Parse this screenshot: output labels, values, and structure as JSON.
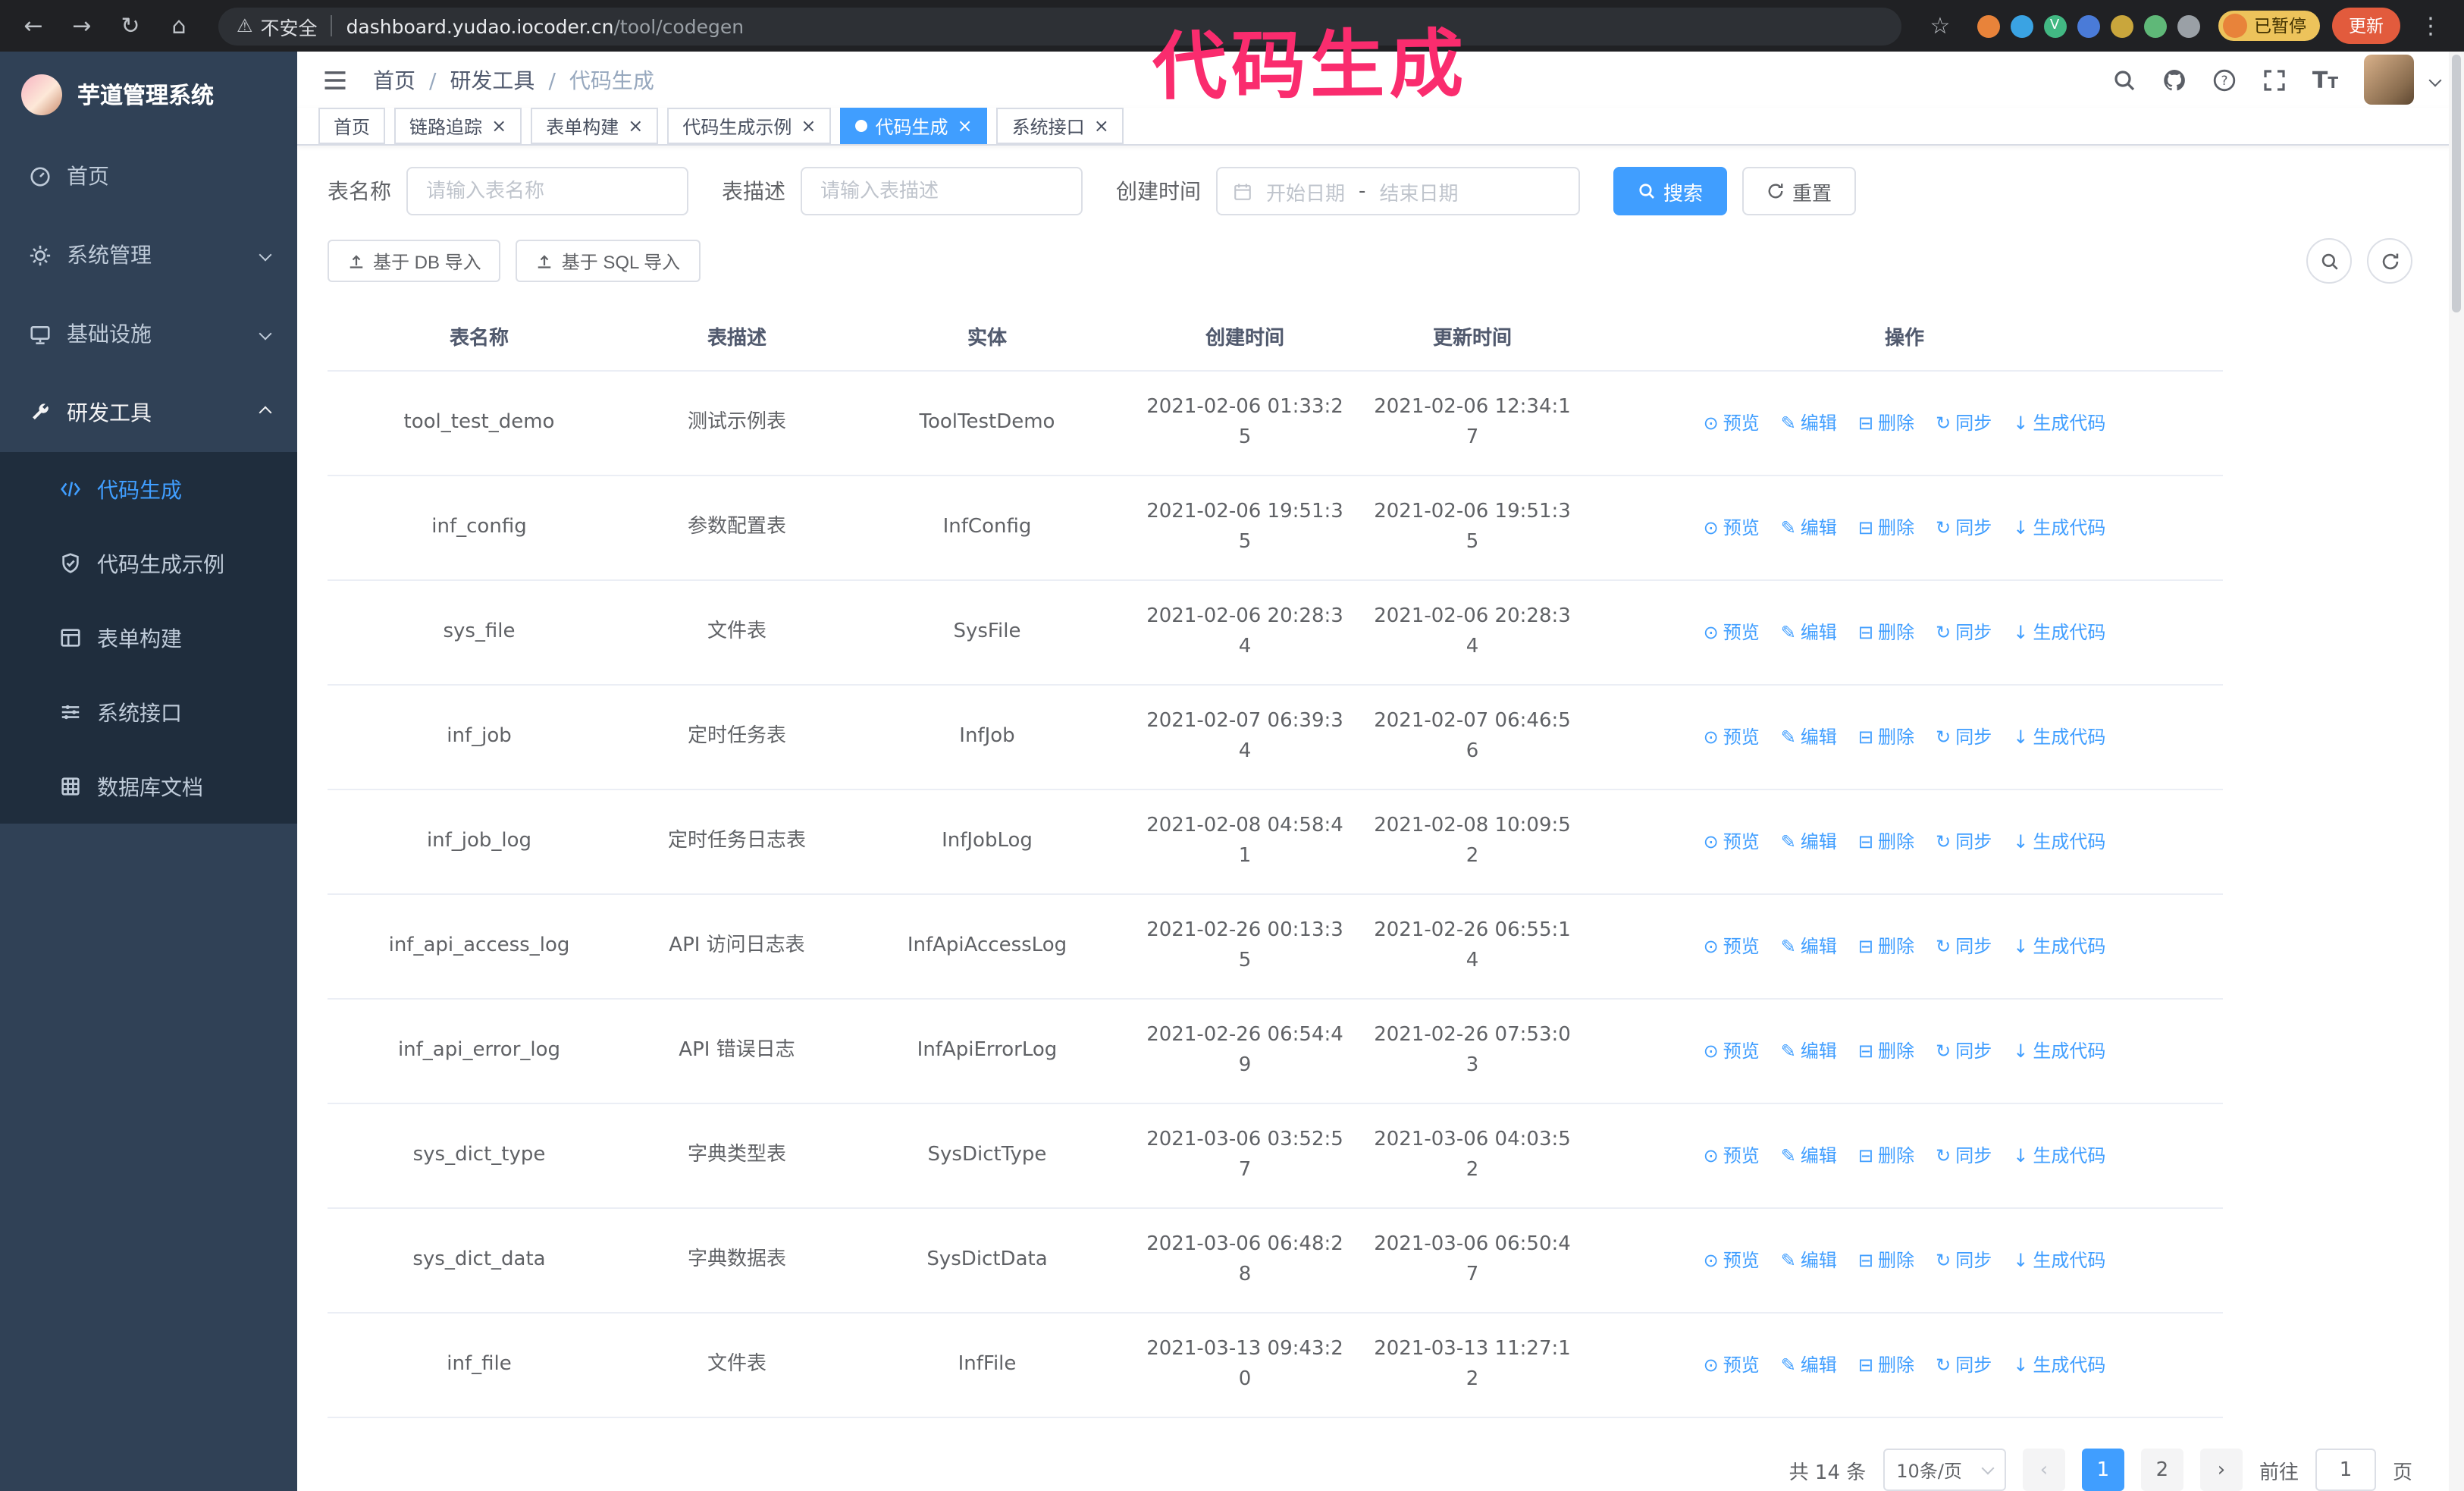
{
  "colors": {
    "accent": "#409eff",
    "annotation": "#fa2c6e",
    "sidebar_bg": "#304156",
    "submenu_bg": "#1f2d3d",
    "tab_active_bg": "#409eff"
  },
  "annotation": {
    "text": "代码生成"
  },
  "browser": {
    "security_label": "不安全",
    "domain": "dashboard.yudao.iocoder.cn",
    "path": "/tool/codegen",
    "profile_badge": "已暂停",
    "update_button": "更新",
    "extensions": [
      {
        "name": "extension-icon",
        "color": "#e8833a"
      },
      {
        "name": "extension-icon",
        "color": "#3aa3e3"
      },
      {
        "name": "vue-devtools-extension-icon",
        "color": "#42b883",
        "label": "V"
      },
      {
        "name": "extension-icon",
        "color": "#4a7bd8"
      },
      {
        "name": "extension-icon",
        "color": "#c9a63c"
      },
      {
        "name": "extension-icon",
        "color": "#5fb878"
      },
      {
        "name": "extensions-puzzle-icon",
        "color": "#9aa0a6"
      }
    ]
  },
  "sidebar": {
    "logo_title": "芋道管理系统",
    "items": [
      {
        "label": "首页",
        "icon": "dashboard-icon"
      },
      {
        "label": "系统管理",
        "icon": "gear-icon"
      },
      {
        "label": "基础设施",
        "icon": "infrastructure-icon"
      },
      {
        "label": "研发工具",
        "icon": "tools-icon"
      }
    ],
    "submenu": [
      {
        "label": "代码生成",
        "icon": "code-icon",
        "active": true
      },
      {
        "label": "代码生成示例",
        "icon": "example-icon"
      },
      {
        "label": "表单构建",
        "icon": "form-icon"
      },
      {
        "label": "系统接口",
        "icon": "api-icon"
      },
      {
        "label": "数据库文档",
        "icon": "database-icon"
      }
    ]
  },
  "header": {
    "breadcrumb": [
      "首页",
      "研发工具",
      "代码生成"
    ]
  },
  "tabs": [
    {
      "label": "首页",
      "closable": false,
      "active": false
    },
    {
      "label": "链路追踪",
      "closable": true,
      "active": false
    },
    {
      "label": "表单构建",
      "closable": true,
      "active": false
    },
    {
      "label": "代码生成示例",
      "closable": true,
      "active": false
    },
    {
      "label": "代码生成",
      "closable": true,
      "active": true
    },
    {
      "label": "系统接口",
      "closable": true,
      "active": false
    }
  ],
  "filters": {
    "table_name_label": "表名称",
    "table_name_placeholder": "请输入表名称",
    "table_desc_label": "表描述",
    "table_desc_placeholder": "请输入表描述",
    "create_time_label": "创建时间",
    "date_start_placeholder": "开始日期",
    "date_separator": "-",
    "date_end_placeholder": "结束日期",
    "search_button": "搜索",
    "reset_button": "重置"
  },
  "toolbar": {
    "import_db_label": "基于 DB 导入",
    "import_sql_label": "基于 SQL 导入"
  },
  "table": {
    "columns": [
      "表名称",
      "表描述",
      "实体",
      "创建时间",
      "更新时间",
      "操作"
    ],
    "actions": [
      {
        "label": "预览",
        "icon": "eye-icon",
        "name": "preview"
      },
      {
        "label": "编辑",
        "icon": "edit-icon",
        "name": "edit"
      },
      {
        "label": "删除",
        "icon": "trash-icon",
        "name": "delete"
      },
      {
        "label": "同步",
        "icon": "sync-icon",
        "name": "sync"
      },
      {
        "label": "生成代码",
        "icon": "generate-icon",
        "name": "generate-code"
      }
    ],
    "rows": [
      {
        "name": "tool_test_demo",
        "desc": "测试示例表",
        "entity": "ToolTestDemo",
        "created": "2021-02-06 01:33:25",
        "updated": "2021-02-06 12:34:17"
      },
      {
        "name": "inf_config",
        "desc": "参数配置表",
        "entity": "InfConfig",
        "created": "2021-02-06 19:51:35",
        "updated": "2021-02-06 19:51:35"
      },
      {
        "name": "sys_file",
        "desc": "文件表",
        "entity": "SysFile",
        "created": "2021-02-06 20:28:34",
        "updated": "2021-02-06 20:28:34"
      },
      {
        "name": "inf_job",
        "desc": "定时任务表",
        "entity": "InfJob",
        "created": "2021-02-07 06:39:34",
        "updated": "2021-02-07 06:46:56"
      },
      {
        "name": "inf_job_log",
        "desc": "定时任务日志表",
        "entity": "InfJobLog",
        "created": "2021-02-08 04:58:41",
        "updated": "2021-02-08 10:09:52"
      },
      {
        "name": "inf_api_access_log",
        "desc": "API 访问日志表",
        "entity": "InfApiAccessLog",
        "created": "2021-02-26 00:13:35",
        "updated": "2021-02-26 06:55:14"
      },
      {
        "name": "inf_api_error_log",
        "desc": "API 错误日志",
        "entity": "InfApiErrorLog",
        "created": "2021-02-26 06:54:49",
        "updated": "2021-02-26 07:53:03"
      },
      {
        "name": "sys_dict_type",
        "desc": "字典类型表",
        "entity": "SysDictType",
        "created": "2021-03-06 03:52:57",
        "updated": "2021-03-06 04:03:52"
      },
      {
        "name": "sys_dict_data",
        "desc": "字典数据表",
        "entity": "SysDictData",
        "created": "2021-03-06 06:48:28",
        "updated": "2021-03-06 06:50:47"
      },
      {
        "name": "inf_file",
        "desc": "文件表",
        "entity": "InfFile",
        "created": "2021-03-13 09:43:20",
        "updated": "2021-03-13 11:27:12"
      }
    ]
  },
  "pagination": {
    "total": "共 14 条",
    "page_size": "10条/页",
    "pages": [
      "1",
      "2"
    ],
    "active_page": "1",
    "prev_icon": "‹",
    "next_icon": "›",
    "goto_label": "前往",
    "goto_value": "1",
    "goto_suffix": "页"
  }
}
